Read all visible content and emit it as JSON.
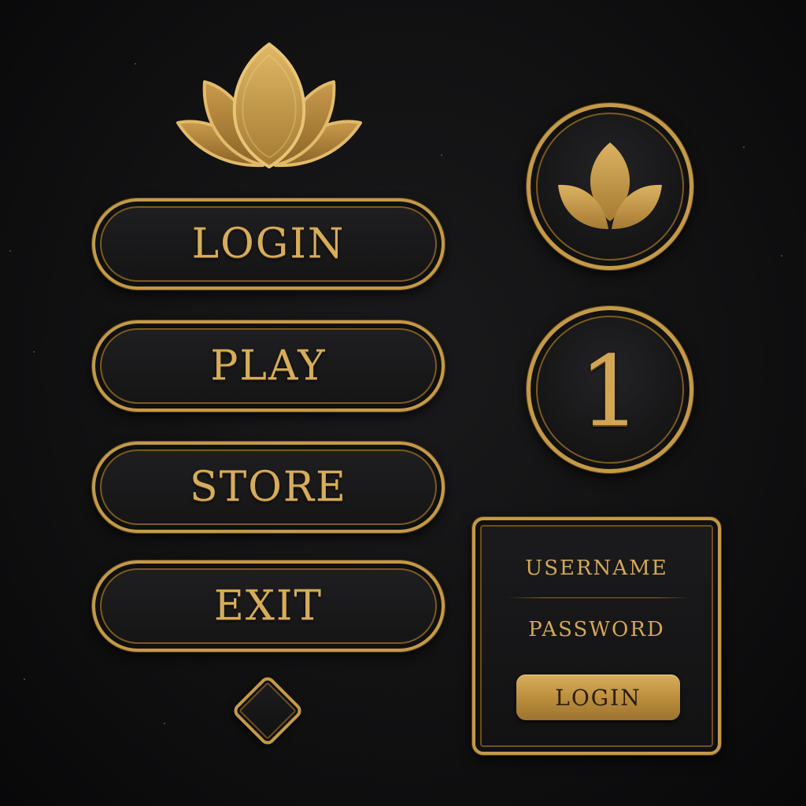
{
  "menu": {
    "login_label": "LOGIN",
    "play_label": "PLAY",
    "store_label": "STORE",
    "exit_label": "EXIT"
  },
  "side": {
    "number_badge": "1"
  },
  "login_panel": {
    "username_label": "USERNAME",
    "password_label": "PASSWORD",
    "login_button_label": "LOGIN"
  },
  "icons": {
    "logo": "lotus-icon",
    "round_button": "leaf-icon",
    "diamond": "diamond-icon"
  },
  "colors": {
    "background": "#111112",
    "gold": "#c49a48",
    "gold_text": "#d6ad5c"
  }
}
